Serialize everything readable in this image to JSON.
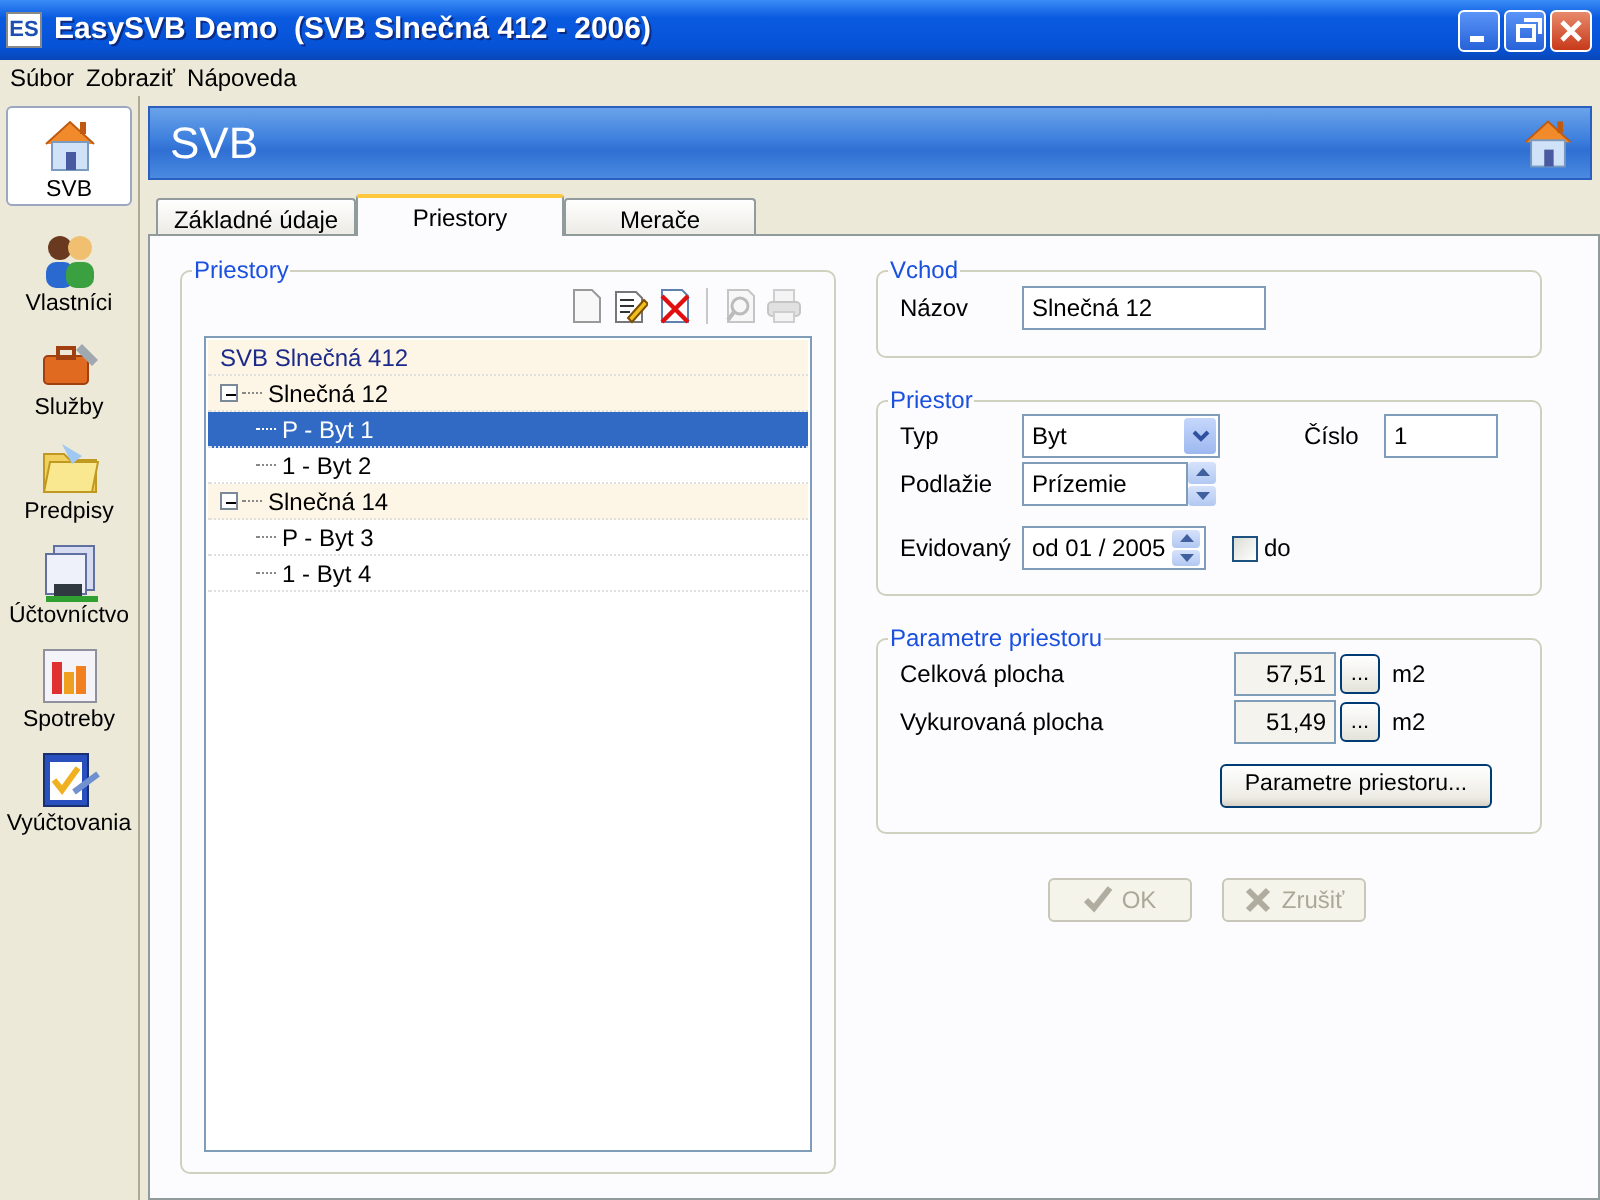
{
  "window": {
    "title": "EasySVB Demo  (SVB Slnečná 412 - 2006)",
    "app_icon": "ES"
  },
  "menu": [
    "Súbor",
    "Zobraziť",
    "Nápoveda"
  ],
  "sidebar": {
    "items": [
      {
        "label": "SVB",
        "kind": "house",
        "selected": true
      },
      {
        "label": "Vlastníci",
        "kind": "people",
        "selected": false
      },
      {
        "label": "Služby",
        "kind": "toolbox",
        "selected": false
      },
      {
        "label": "Predpisy",
        "kind": "folder",
        "selected": false
      },
      {
        "label": "Účtovníctvo",
        "kind": "ledger",
        "selected": false
      },
      {
        "label": "Spotreby",
        "kind": "chart",
        "selected": false
      },
      {
        "label": "Vyúčtovania",
        "kind": "check",
        "selected": false
      }
    ]
  },
  "header": {
    "title": "SVB"
  },
  "tabs": [
    {
      "label": "Základné údaje",
      "selected": false
    },
    {
      "label": "Priestory",
      "selected": true
    },
    {
      "label": "Merače",
      "selected": false
    }
  ],
  "priestory": {
    "title": "Priestory",
    "toolbar": [
      {
        "kind": "new",
        "disabled": false
      },
      {
        "kind": "edit",
        "disabled": false
      },
      {
        "kind": "delete",
        "disabled": false
      },
      {
        "kind": "preview",
        "disabled": true
      },
      {
        "kind": "print",
        "disabled": true
      }
    ],
    "tree": [
      {
        "label": "SVB Slnečná 412",
        "selected": false,
        "children": [
          {
            "label": "Slnečná 12",
            "selected": false,
            "expanded": true,
            "children": [
              {
                "label": "P - Byt 1",
                "selected": true
              },
              {
                "label": "1 - Byt 2",
                "selected": false
              }
            ]
          },
          {
            "label": "Slnečná 14",
            "selected": false,
            "expanded": true,
            "children": [
              {
                "label": "P - Byt 3",
                "selected": false
              },
              {
                "label": "1 - Byt 4",
                "selected": false
              }
            ]
          }
        ]
      }
    ]
  },
  "vchod": {
    "title": "Vchod",
    "nazov_label": "Názov",
    "nazov_value": "Slnečná 12"
  },
  "priestor": {
    "title": "Priestor",
    "typ_label": "Typ",
    "typ_value": "Byt",
    "cislo_label": "Číslo",
    "cislo_value": "1",
    "podlazie_label": "Podlažie",
    "podlazie_value": "Prízemie",
    "evidovany_label": "Evidovaný",
    "evidovany_value": "od 01 / 2005",
    "do_label": "do",
    "do_checked": false
  },
  "parametre": {
    "title": "Parametre priestoru",
    "rows": [
      {
        "label": "Celková plocha",
        "value": "57,51",
        "more": "...",
        "unit": "m2"
      },
      {
        "label": "Vykurovaná plocha",
        "value": "51,49",
        "more": "...",
        "unit": "m2"
      }
    ],
    "button": "Parametre priestoru..."
  },
  "actions": [
    {
      "label": "OK",
      "kind": "ok",
      "disabled": true
    },
    {
      "label": "Zrušiť",
      "kind": "cancel",
      "disabled": true
    }
  ]
}
